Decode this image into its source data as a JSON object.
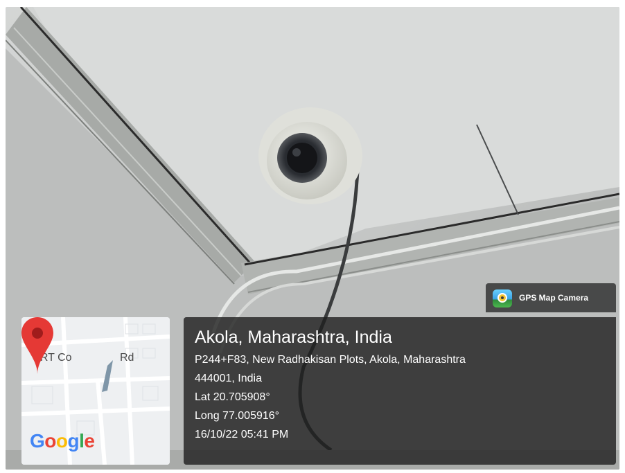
{
  "app": {
    "name": "GPS Map Camera",
    "icon": "gps-map-camera-app-icon"
  },
  "location": {
    "title": "Akola, Maharashtra, India",
    "address_line_1": "P244+F83, New Radhakisan Plots, Akola, Maharashtra",
    "address_line_2": "444001, India",
    "latitude": "Lat 20.705908°",
    "longitude": "Long 77.005916°",
    "datetime": "16/10/22 05:41 PM"
  },
  "map": {
    "road_label_left": "LRT Co",
    "road_label_right": "Rd",
    "pin_icon": "map-pin-icon",
    "pin_color": "#e53935",
    "logo_letters": [
      "G",
      "o",
      "o",
      "g",
      "l",
      "e"
    ],
    "logo_colors": [
      "#4285F4",
      "#EA4335",
      "#FBBC05",
      "#4285F4",
      "#34A853",
      "#EA4335"
    ]
  },
  "photo": {
    "subject": "cctv-dome-camera",
    "ceiling_color": "#c9cbcb"
  }
}
